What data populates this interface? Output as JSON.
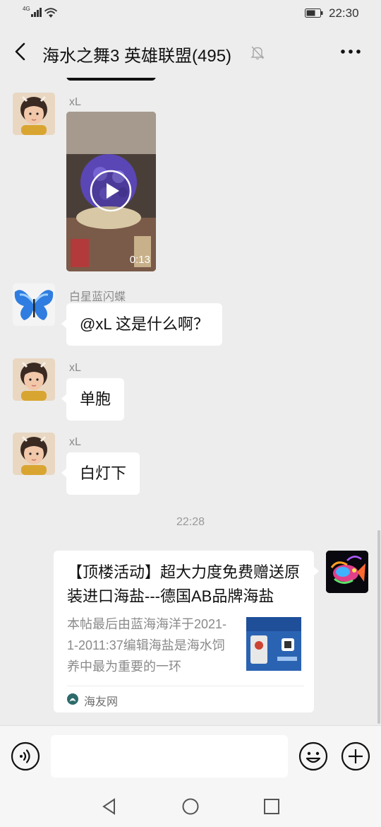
{
  "status_bar": {
    "network": "4G",
    "time": "22:30"
  },
  "header": {
    "title": "海水之舞3 英雄联盟(495)",
    "back_icon": "back-chevron-icon",
    "mute_icon": "bell-muted-icon",
    "more_icon": "more-dots-icon"
  },
  "messages": [
    {
      "type": "video",
      "sender": "xL",
      "duration": "0:13"
    },
    {
      "type": "text",
      "sender": "白星蓝闪蝶",
      "text": "@xL  这是什么啊？"
    },
    {
      "type": "text",
      "sender": "xL",
      "text": "单胞"
    },
    {
      "type": "text",
      "sender": "xL",
      "text": "白灯下"
    }
  ],
  "timestamp": "22:28",
  "link_card": {
    "title": "【顶楼活动】超大力度免费赠送原装进口海盐---德国AB品牌海盐",
    "description": "本帖最后由蓝海海洋于2021-1-2011:37编辑海盐是海水饲养中最为重要的一环",
    "source": "海友网"
  },
  "input_bar": {
    "voice_icon": "voice-icon",
    "emoji_icon": "emoji-icon",
    "plus_icon": "plus-icon"
  },
  "nav_bar": {
    "back": "nav-back-icon",
    "home": "nav-home-icon",
    "recent": "nav-recent-icon"
  }
}
